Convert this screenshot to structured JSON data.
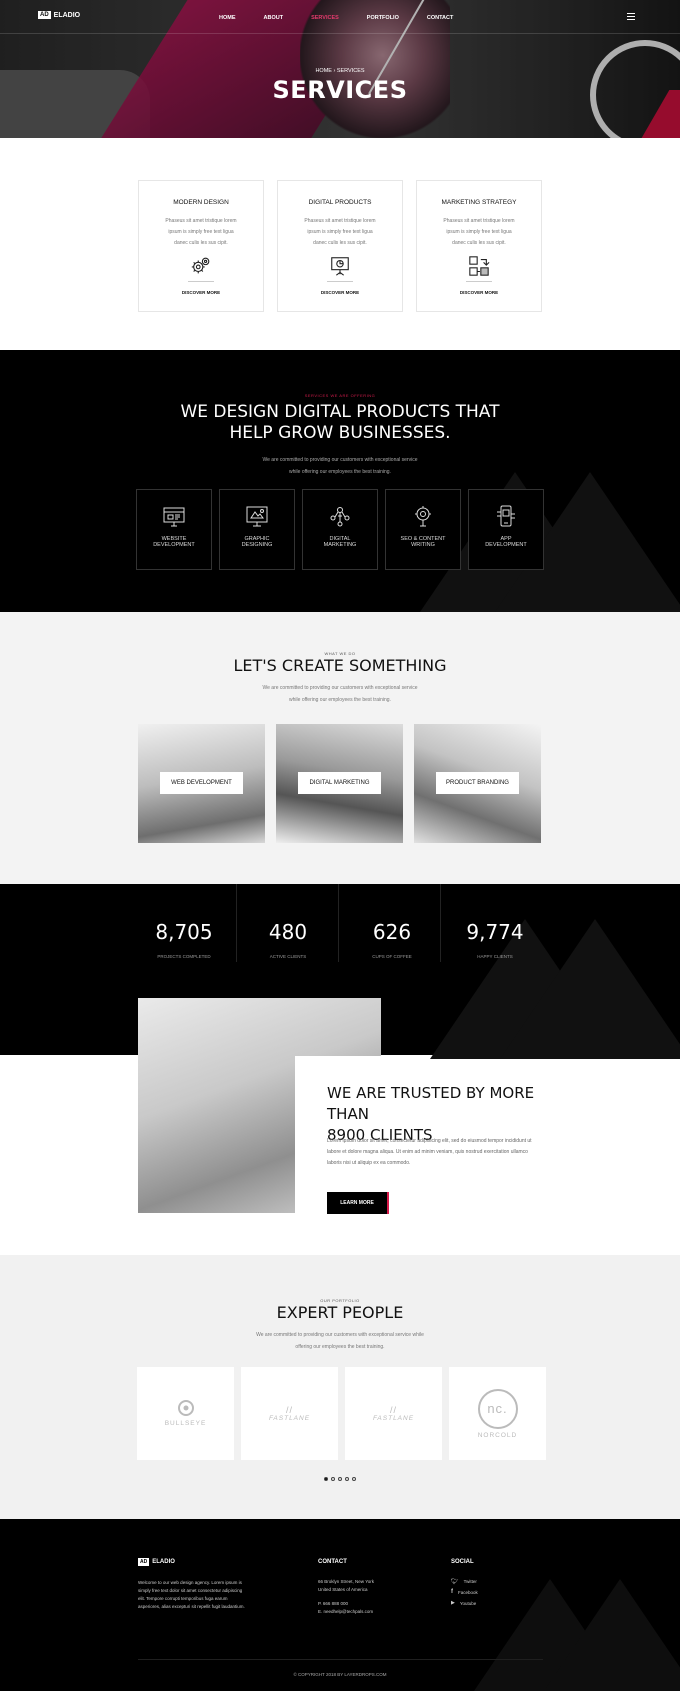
{
  "nav": {
    "logo_mark": "AD",
    "logo_text": "ELADIO",
    "items": [
      "HOME",
      "ABOUT",
      "SERVICES",
      "PORTFOLIO",
      "CONTACT"
    ]
  },
  "hero": {
    "breadcrumb": "HOME › SERVICES",
    "title": "SERVICES"
  },
  "cards": [
    {
      "title": "MODERN DESIGN",
      "text": "Phaseus sit amet tristique lorem ipsum is simply free text ligua danec culis les sus cipit.",
      "link": "DISCOVER MORE",
      "icon": "gears-icon"
    },
    {
      "title": "DIGITAL PRODUCTS",
      "text": "Phaseus sit amet tristique lorem ipsum is simply free text ligua danec culis les sus cipit.",
      "link": "DISCOVER MORE",
      "icon": "presentation-icon"
    },
    {
      "title": "MARKETING STRATEGY",
      "text": "Phaseus sit amet tristique lorem ipsum is simply free text ligua danec culis les sus cipit.",
      "link": "DISCOVER MORE",
      "icon": "workflow-icon"
    }
  ],
  "offer": {
    "kicker": "SERVICES WE ARE OFFERING",
    "title_line1": "WE DESIGN DIGITAL PRODUCTS THAT",
    "title_line2": "HELP GROW BUSINESSES.",
    "sub_line1": "We are committed to providing our customers with exceptional service",
    "sub_line2": "while offering our employees the best training.",
    "services": [
      {
        "l1": "WEBSITE",
        "l2": "DEVELOPMENT"
      },
      {
        "l1": "GRAPHIC",
        "l2": "DESIGNING"
      },
      {
        "l1": "DIGITAL",
        "l2": "MARKETING"
      },
      {
        "l1": "SEO & CONTENT",
        "l2": "WRITING"
      },
      {
        "l1": "APP",
        "l2": "DEVELOPMENT"
      }
    ]
  },
  "create": {
    "kicker": "WHAT WE DO",
    "title": "LET'S CREATE SOMETHING",
    "sub_line1": "We are committed to providing our customers with exceptional service",
    "sub_line2": "while offering our employees the best training.",
    "photos": [
      "WEB DEVELOPMENT",
      "DIGITAL MARKETING",
      "PRODUCT BRANDING"
    ]
  },
  "stats": [
    {
      "n": "8,705",
      "l": "PROJECTS COMPLETED"
    },
    {
      "n": "480",
      "l": "ACTIVE CLIENTS"
    },
    {
      "n": "626",
      "l": "CUPS OF COFFEE"
    },
    {
      "n": "9,774",
      "l": "HAPPY CLIENTS"
    }
  ],
  "trusted": {
    "title_line1": "WE ARE TRUSTED BY MORE THAN",
    "title_line2": "8900 CLIENTS",
    "text": "Lorem ipsum dolor sit amet, consectetur adipisicing elit, sed do eiusmod tempor incididunt ut labore et dolore magna aliqua. Ut enim ad minim veniam, quis nostrud exercitation ullamco laboris nisi ut aliquip ex ea commodo.",
    "button": "LEARN MORE"
  },
  "expert": {
    "kicker": "OUR PORTFOLIO",
    "title": "EXPERT PEOPLE",
    "sub_line1": "We are committed to providing our customers with exceptional service while",
    "sub_line2": "offering our employees the best training.",
    "logos": [
      "BULLSEYE",
      "FASTLANE",
      "FASTLANE",
      "NORCOLD"
    ],
    "logo_mark": "nc.",
    "dots": 5
  },
  "footer": {
    "logo_mark": "AD",
    "logo_text": "ELADIO",
    "about": "Welcome to our web design agency. Lorem ipsum is simply free text dolor sit amet consectetur adipiscing elit. Tempore corrupti temporibus fuga earum asperiores, alias excepturi sit repellit fugit laudantium.",
    "contact_title": "CONTACT",
    "address1": "66 Broklyn Street, New York",
    "address2": "United States of America",
    "phone": "P. 666 888 000",
    "email": "E. needhelp@techpals.com",
    "social_title": "SOCIAL",
    "social": [
      "Twitter",
      "Facebook",
      "Youtube"
    ],
    "copyright": "© COPYRIGHT 2018 BY LAYERDROPS.COM"
  },
  "colors": {
    "accent": "#e23a6c",
    "dark": "#000000",
    "light_bg": "#f3f3f3"
  }
}
